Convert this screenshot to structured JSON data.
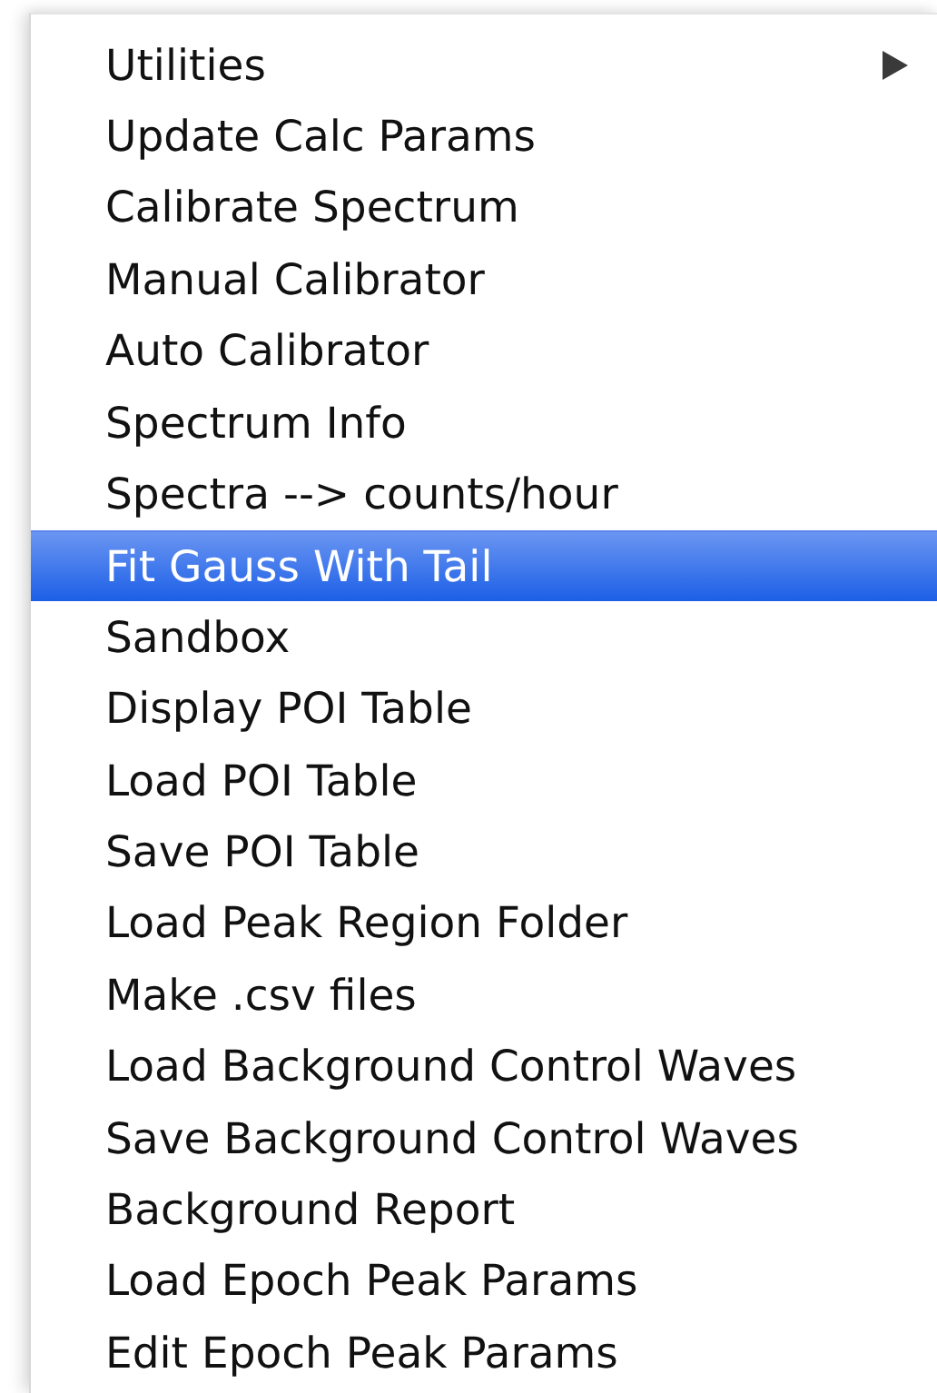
{
  "menu": {
    "items": [
      {
        "label": "Utilities",
        "submenu": true,
        "selected": false
      },
      {
        "label": "Update Calc Params",
        "submenu": false,
        "selected": false
      },
      {
        "label": "Calibrate Spectrum",
        "submenu": false,
        "selected": false
      },
      {
        "label": "Manual Calibrator",
        "submenu": false,
        "selected": false
      },
      {
        "label": "Auto Calibrator",
        "submenu": false,
        "selected": false
      },
      {
        "label": "Spectrum Info",
        "submenu": false,
        "selected": false
      },
      {
        "label": "Spectra --> counts/hour",
        "submenu": false,
        "selected": false
      },
      {
        "label": "Fit Gauss With Tail",
        "submenu": false,
        "selected": true
      },
      {
        "label": "Sandbox",
        "submenu": false,
        "selected": false
      },
      {
        "label": "Display POI Table",
        "submenu": false,
        "selected": false
      },
      {
        "label": "Load POI Table",
        "submenu": false,
        "selected": false
      },
      {
        "label": "Save POI Table",
        "submenu": false,
        "selected": false
      },
      {
        "label": "Load Peak Region Folder",
        "submenu": false,
        "selected": false
      },
      {
        "label": "Make .csv files",
        "submenu": false,
        "selected": false
      },
      {
        "label": "Load Background Control Waves",
        "submenu": false,
        "selected": false
      },
      {
        "label": "Save Background Control Waves",
        "submenu": false,
        "selected": false
      },
      {
        "label": "Background Report",
        "submenu": false,
        "selected": false
      },
      {
        "label": "Load Epoch Peak Params",
        "submenu": false,
        "selected": false
      },
      {
        "label": "Edit Epoch Peak Params",
        "submenu": false,
        "selected": false
      }
    ]
  }
}
